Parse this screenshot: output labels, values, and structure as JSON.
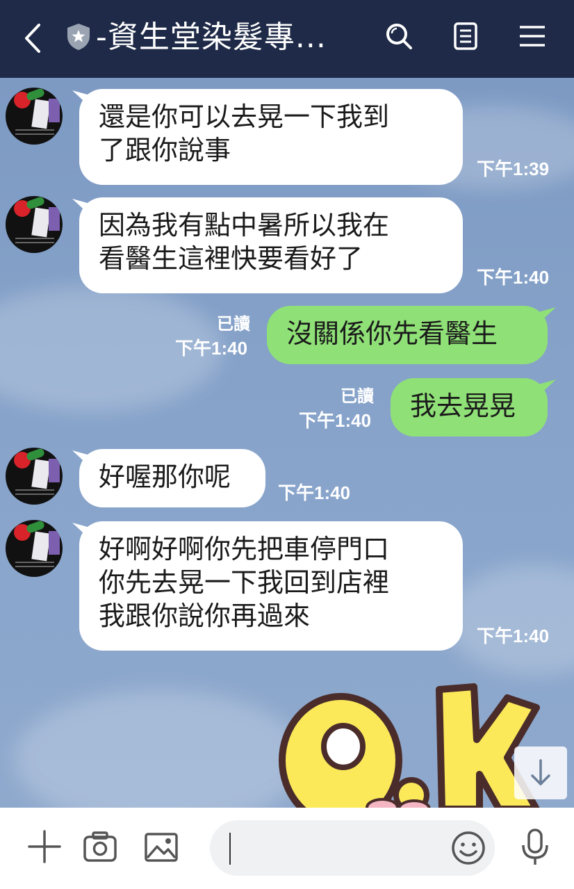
{
  "header": {
    "title": "-資生堂染髮專...",
    "icons": [
      "back-chevron-icon",
      "shield-icon",
      "search-icon",
      "notes-icon",
      "menu-icon"
    ]
  },
  "messages": [
    {
      "side": "in",
      "text": "還是你可以去晃一下我到\n了跟你說事",
      "time": "下午1:39"
    },
    {
      "side": "in",
      "text": "因為我有點中暑所以我在\n看醫生這裡快要看好了",
      "time": "下午1:40"
    },
    {
      "side": "out",
      "text": "沒關係你先看醫生",
      "time": "下午1:40",
      "read": "已讀"
    },
    {
      "side": "out",
      "text": "我去晃晃",
      "time": "下午1:40",
      "read": "已讀"
    },
    {
      "side": "in",
      "text": "好喔那你呢",
      "time": "下午1:40"
    },
    {
      "side": "in",
      "text": "好啊好啊你先把車停門口\n你先去晃一下我回到店裡\n我跟你說你再過來",
      "time": "下午1:40"
    }
  ],
  "sticker": {
    "text": "OK",
    "fill": "#fbe95a",
    "outline": "#4a2c2a"
  },
  "input": {
    "placeholder": "",
    "icons": [
      "plus-icon",
      "camera-icon",
      "image-icon",
      "emoji-icon",
      "microphone-icon"
    ]
  },
  "colors": {
    "header_bg": "#1e2a47",
    "chat_bg": "#7e9bc4",
    "incoming_bubble": "#ffffff",
    "outgoing_bubble": "#8fe077"
  }
}
